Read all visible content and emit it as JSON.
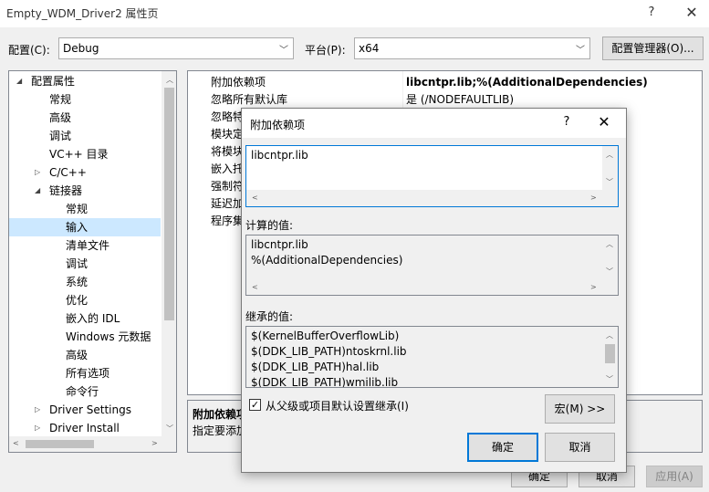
{
  "window": {
    "title": "Empty_WDM_Driver2 属性页",
    "help": "?",
    "close": "✕"
  },
  "config": {
    "config_label": "配置(C):",
    "config_value": "Debug",
    "platform_label": "平台(P):",
    "platform_value": "x64",
    "manager_button": "配置管理器(O)..."
  },
  "tree": {
    "items": [
      {
        "label": "配置属性",
        "expander": "◢"
      },
      {
        "label": "常规"
      },
      {
        "label": "高级"
      },
      {
        "label": "调试"
      },
      {
        "label": "VC++ 目录"
      },
      {
        "label": "C/C++",
        "expander": "▷"
      },
      {
        "label": "链接器",
        "expander": "◢"
      },
      {
        "label": "常规"
      },
      {
        "label": "输入"
      },
      {
        "label": "清单文件"
      },
      {
        "label": "调试"
      },
      {
        "label": "系统"
      },
      {
        "label": "优化"
      },
      {
        "label": "嵌入的 IDL"
      },
      {
        "label": "Windows 元数据"
      },
      {
        "label": "高级"
      },
      {
        "label": "所有选项"
      },
      {
        "label": "命令行"
      },
      {
        "label": "Driver Settings",
        "expander": "▷"
      },
      {
        "label": "Driver Install",
        "expander": "▷"
      }
    ],
    "selected": "输入"
  },
  "grid": {
    "rows": [
      {
        "name": "附加依赖项",
        "value": "libcntpr.lib;%(AdditionalDependencies)"
      },
      {
        "name": "忽略所有默认库",
        "value": "是 (/NODEFAULTLIB)"
      },
      {
        "name": "忽略特",
        "value": ""
      },
      {
        "name": "模块定",
        "value": ""
      },
      {
        "name": "将模块",
        "value": ""
      },
      {
        "name": "嵌入托",
        "value": ""
      },
      {
        "name": "强制符",
        "value": ""
      },
      {
        "name": "延迟加",
        "value": ""
      },
      {
        "name": "程序集",
        "value": ""
      }
    ]
  },
  "description": {
    "title": "附加依赖项",
    "text": "指定要添加"
  },
  "footer": {
    "ok": "确定",
    "cancel": "取消",
    "apply": "应用(A)"
  },
  "dialog": {
    "title": "附加依赖项",
    "help": "?",
    "close": "✕",
    "input_text": "libcntpr.lib",
    "computed_label": "计算的值:",
    "computed_lines": [
      "libcntpr.lib",
      "%(AdditionalDependencies)"
    ],
    "inherited_label": "继承的值:",
    "inherited_lines": [
      "$(KernelBufferOverflowLib)",
      "$(DDK_LIB_PATH)ntoskrnl.lib",
      "$(DDK_LIB_PATH)hal.lib",
      "$(DDK_LIB_PATH)wmilib.lib"
    ],
    "inherit_checkbox_label": "从父级或项目默认设置继承(I)",
    "inherit_checked": true,
    "macro_button": "宏(M) >>",
    "ok": "确定",
    "cancel": "取消"
  },
  "colors": {
    "selection": "#cce8ff",
    "focus_border": "#0078d7"
  }
}
